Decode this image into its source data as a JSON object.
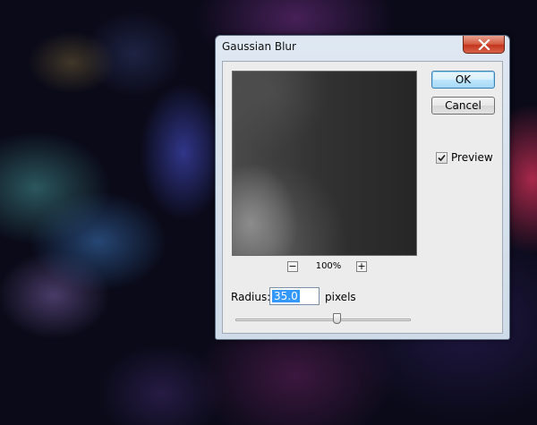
{
  "dialog": {
    "title": "Gaussian Blur",
    "ok_label": "OK",
    "cancel_label": "Cancel",
    "preview_label": "Preview",
    "preview_checked": true,
    "zoom": {
      "minus_label": "−",
      "value": "100%",
      "plus_label": "+"
    },
    "radius": {
      "label": "Radius:",
      "value": "35.0",
      "units": "pixels",
      "slider_fraction": 0.58
    }
  },
  "icons": {
    "close": "close-icon",
    "check": "checkmark-icon"
  }
}
